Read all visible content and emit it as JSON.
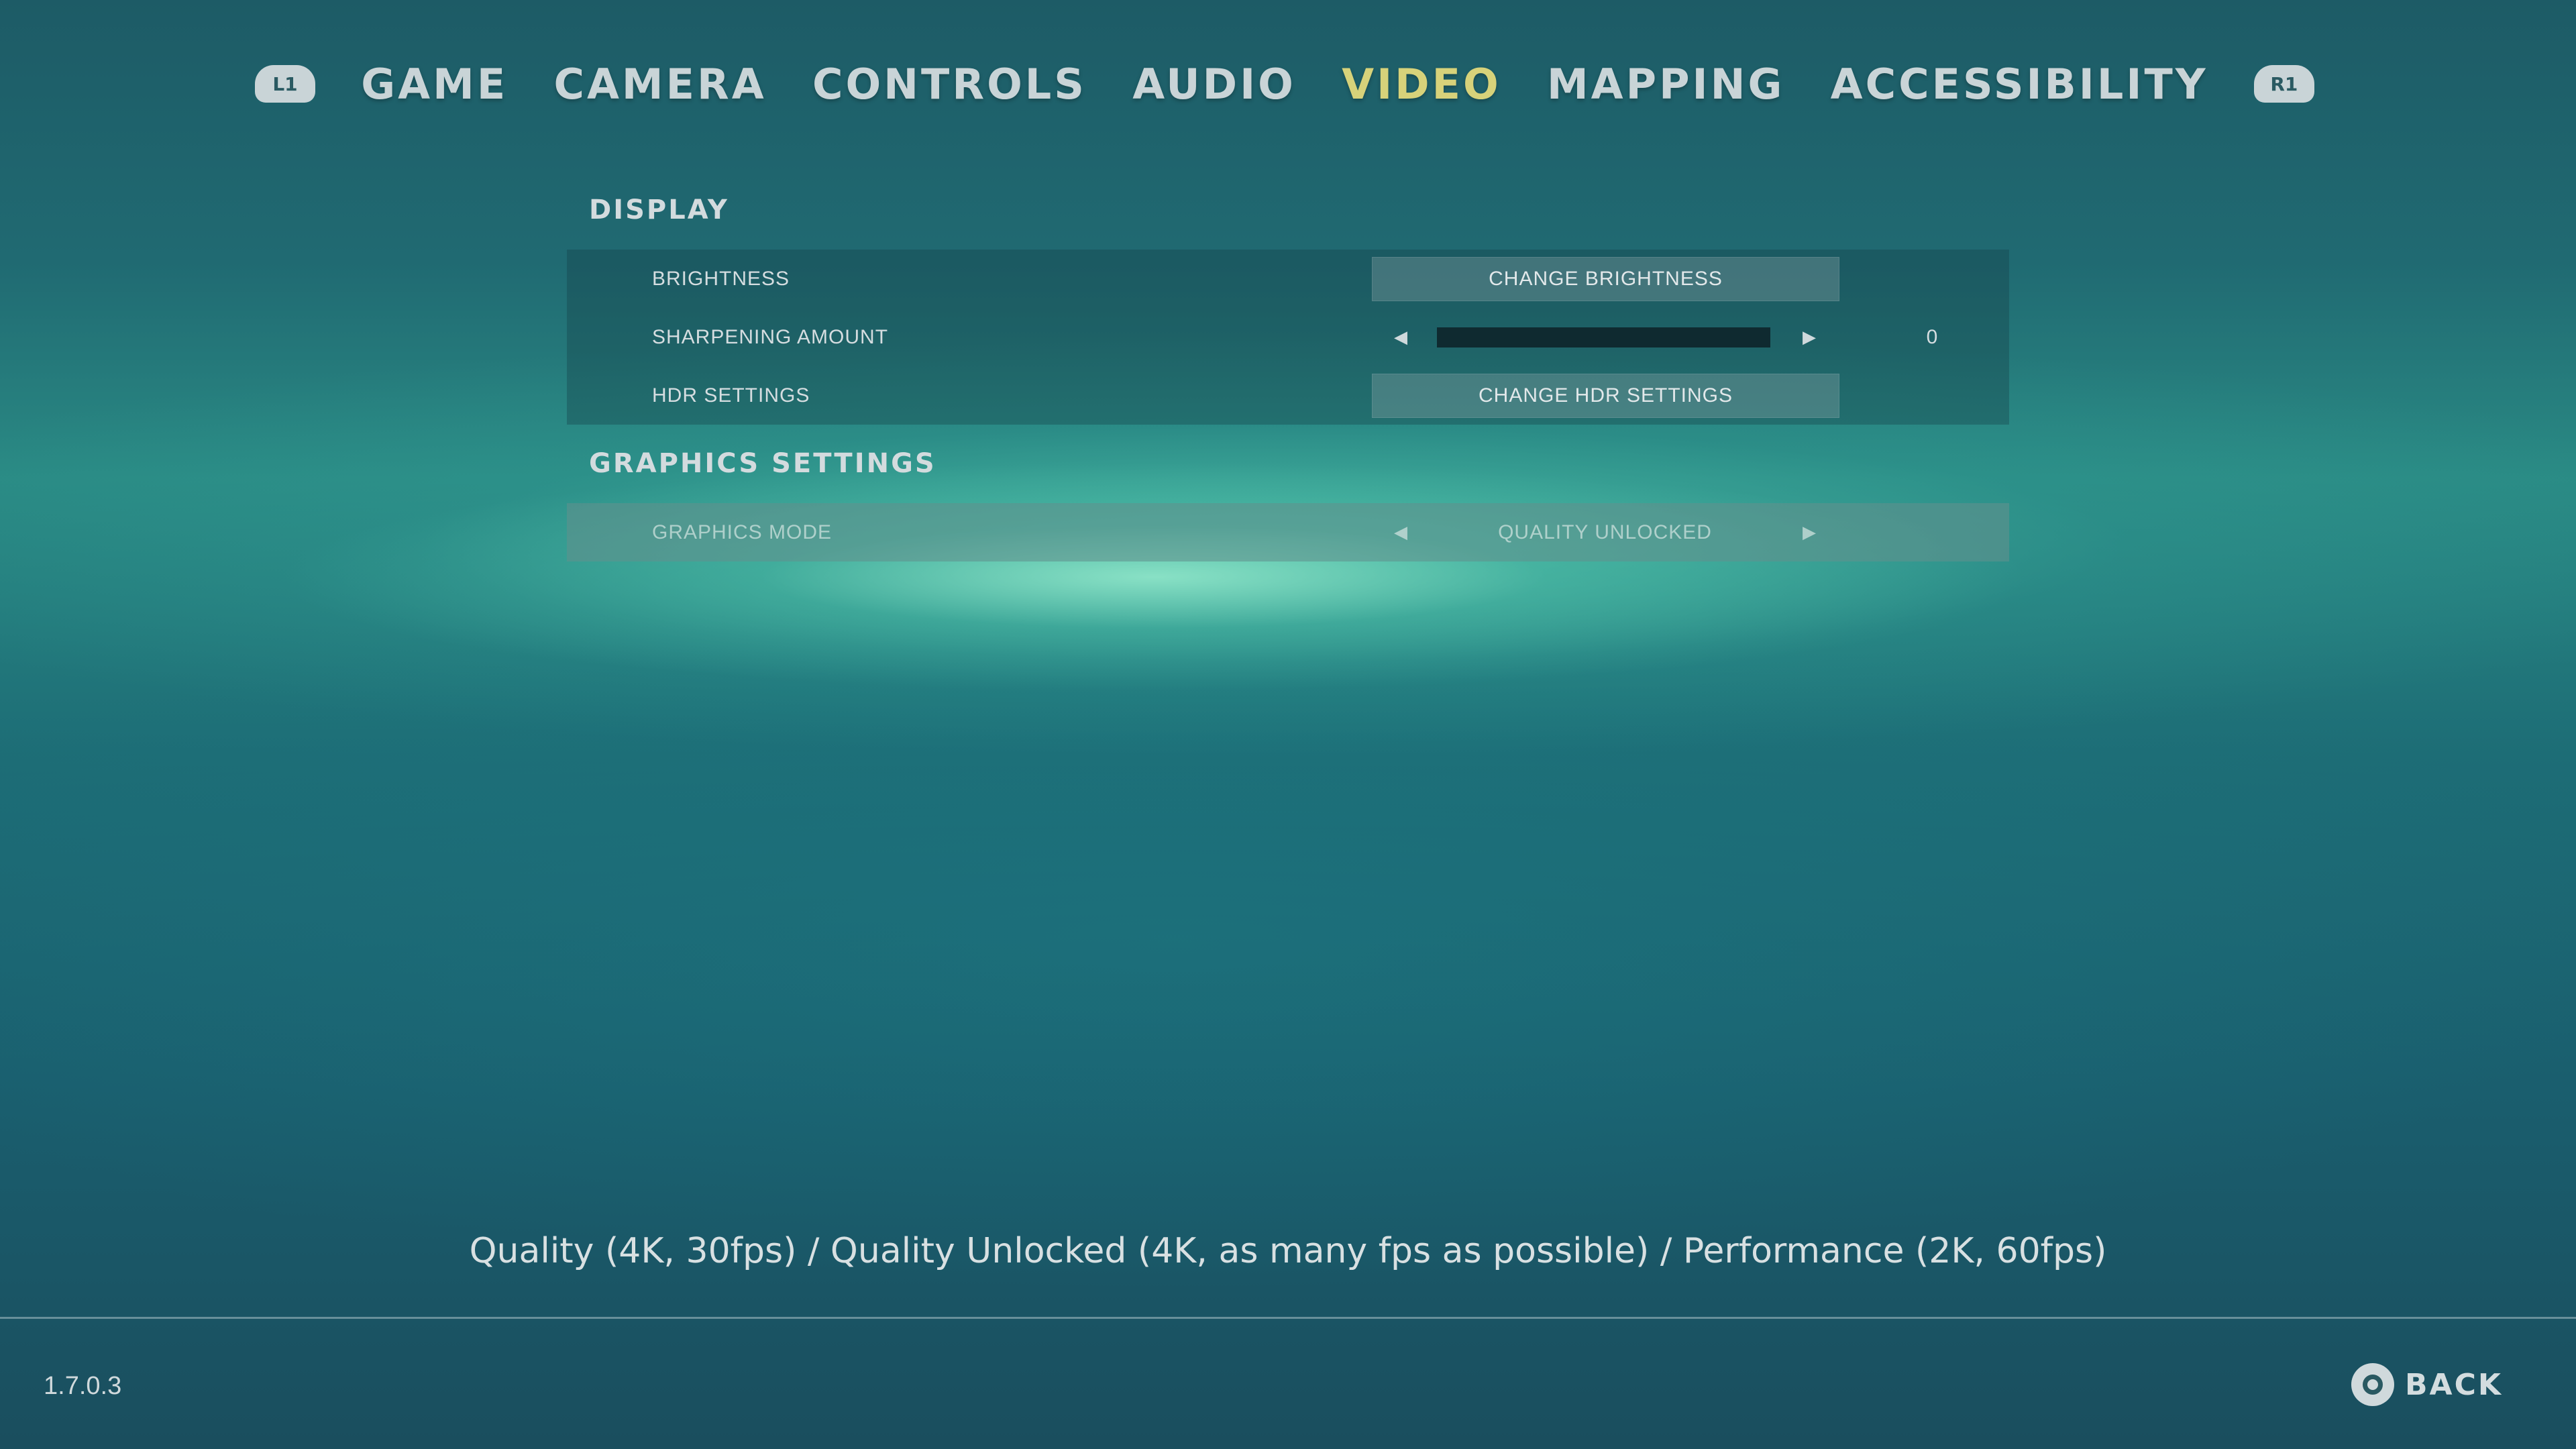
{
  "nav": {
    "left_shoulder": "L1",
    "right_shoulder": "R1",
    "tabs": [
      {
        "label": "GAME"
      },
      {
        "label": "CAMERA"
      },
      {
        "label": "CONTROLS"
      },
      {
        "label": "AUDIO"
      },
      {
        "label": "VIDEO",
        "active": true
      },
      {
        "label": "MAPPING"
      },
      {
        "label": "ACCESSIBILITY"
      }
    ],
    "active_color": "#d7d27a"
  },
  "display": {
    "title": "DISPLAY",
    "brightness": {
      "label": "BRIGHTNESS",
      "button": "CHANGE BRIGHTNESS"
    },
    "sharpening": {
      "label": "SHARPENING AMOUNT",
      "value": "0",
      "fraction": 0,
      "left_arrow": "◀",
      "right_arrow": "▶"
    },
    "hdr": {
      "label": "HDR SETTINGS",
      "button": "CHANGE HDR SETTINGS"
    }
  },
  "graphics": {
    "title": "GRAPHICS SETTINGS",
    "mode": {
      "label": "GRAPHICS MODE",
      "value": "QUALITY UNLOCKED",
      "left_arrow": "◀",
      "right_arrow": "▶"
    }
  },
  "footer": {
    "description": "Quality (4K, 30fps) / Quality Unlocked (4K, as many fps as possible) / Performance (2K, 60fps)",
    "version": "1.7.0.3",
    "back_label": "BACK",
    "back_icon": "circle-button-icon"
  }
}
